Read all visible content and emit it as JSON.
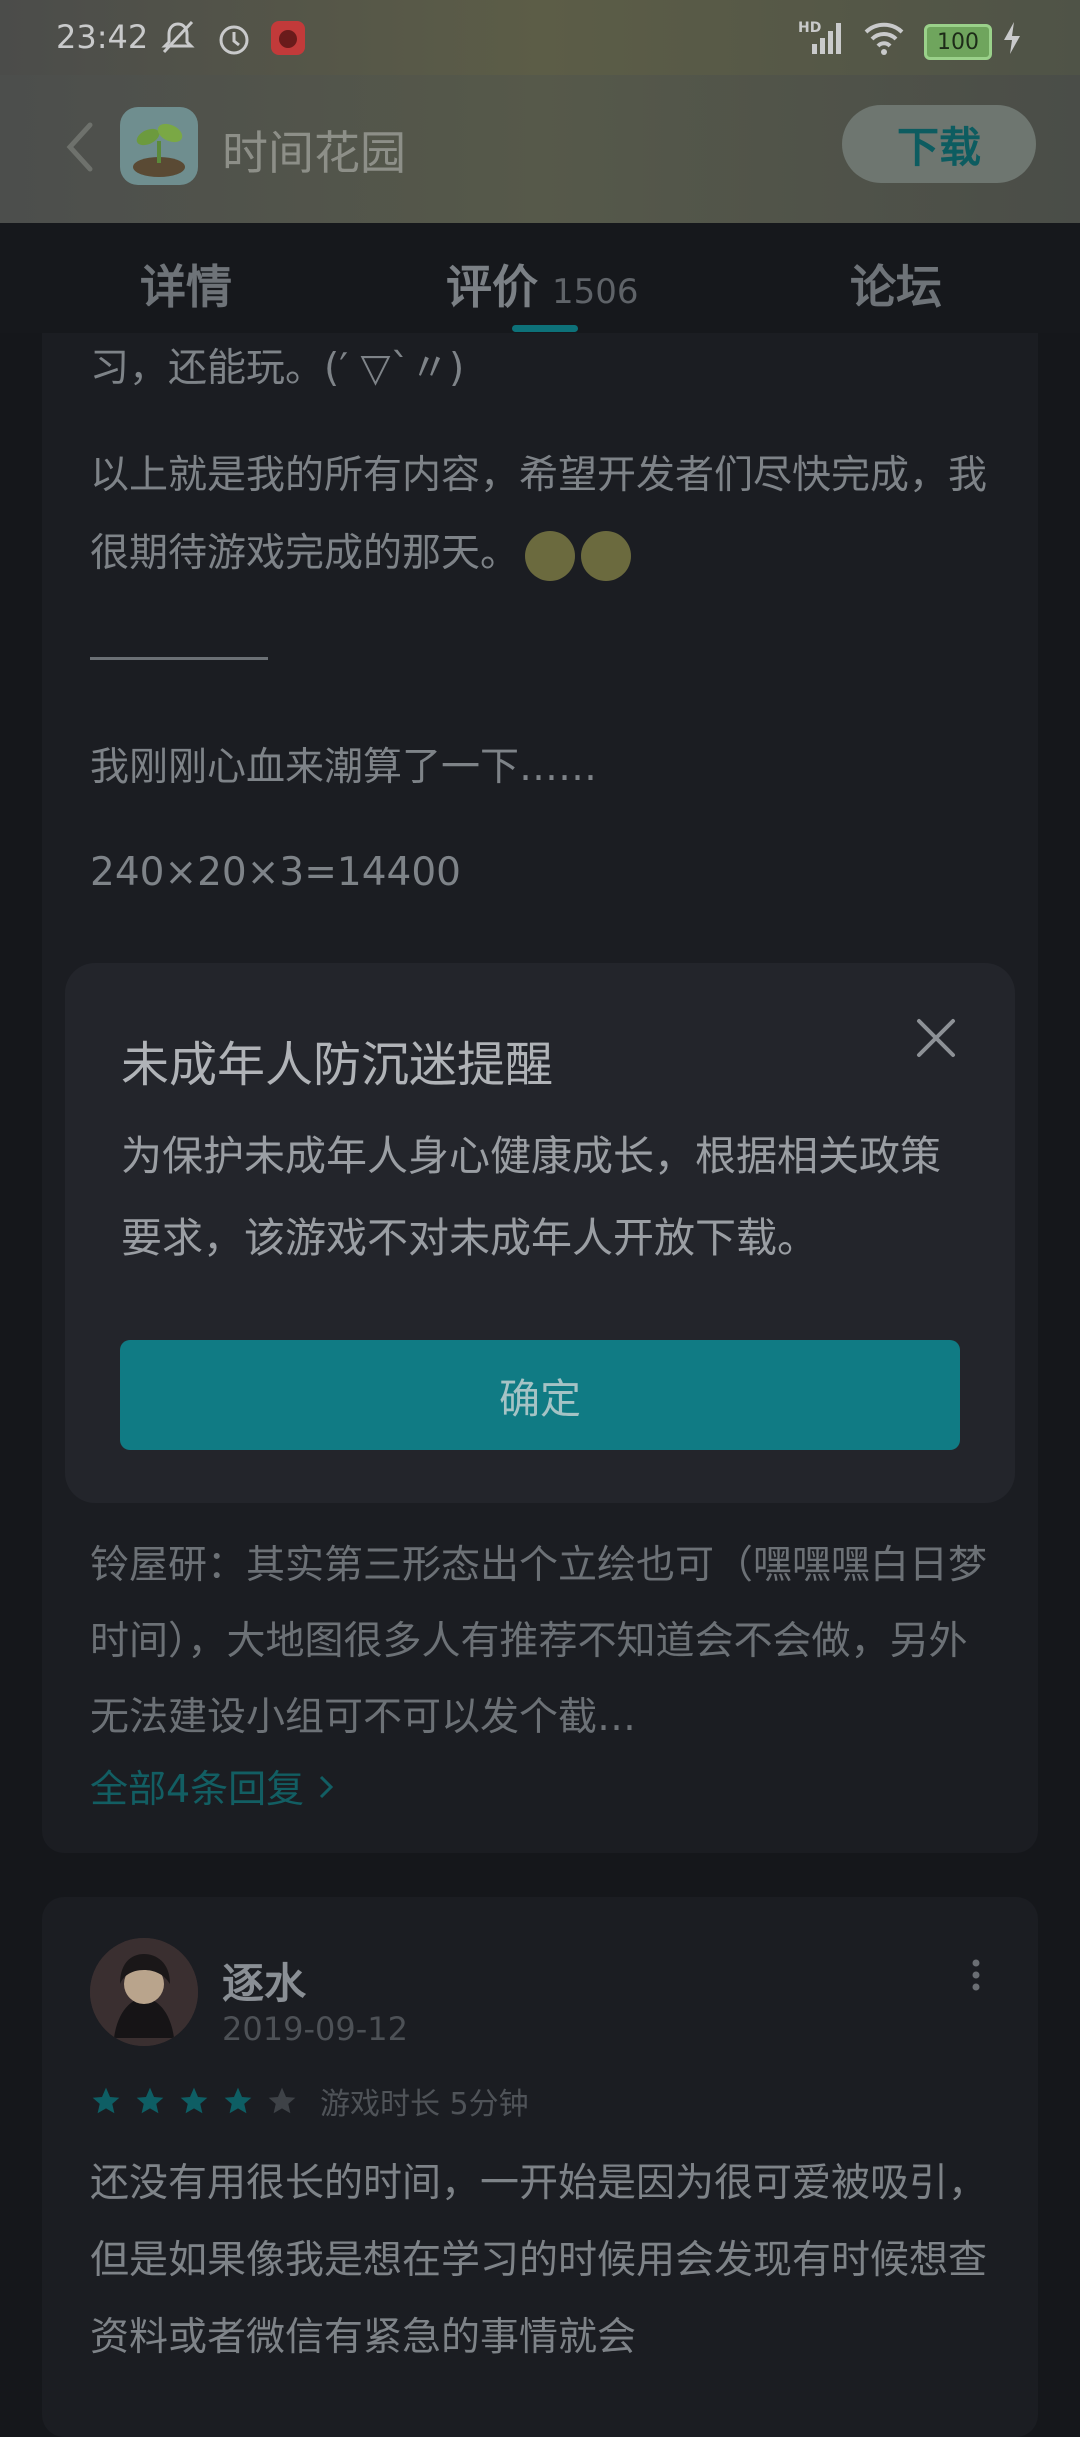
{
  "status_bar": {
    "time": "23:42",
    "battery": "100",
    "network": "HD",
    "icons": [
      "mute-icon",
      "alarm-icon",
      "app-notification-icon",
      "signal-icon",
      "wifi-icon",
      "battery-icon",
      "charging-icon"
    ]
  },
  "app_bar": {
    "title": "时间花园",
    "download_label": "下载"
  },
  "tabs": [
    {
      "label": "详情"
    },
    {
      "label": "评价",
      "count": "1506",
      "active": true
    },
    {
      "label": "论坛"
    }
  ],
  "review1": {
    "line_partial": "习，还能玩。(′ ▽`〃)",
    "para2": "以上就是我的所有内容，希望开发者们尽快完成，我很期待游戏完成的那天。",
    "para3": "我刚刚心血来潮算了一下……",
    "para4": "240×20×3=14400",
    "reply_text": "铃屋研：其实第三形态出个立绘也可（嘿嘿嘿白日梦时间），大地图很多人有推荐不知道会不会做，另外无法建设小组可不可以发个截…",
    "reply_link": "全部4条回复"
  },
  "review2": {
    "user": "逐水",
    "date": "2019-09-12",
    "rating": 4,
    "playtime": "游戏时长 5分钟",
    "text": "还没有用很长的时间，一开始是因为很可爱被吸引，但是如果像我是想在学习的时候用会发现有时候想查资料或者微信有紧急的事情就会"
  },
  "dialog": {
    "title": "未成年人防沉迷提醒",
    "body": "为保护未成年人身心健康成长，根据相关政策要求，该游戏不对未成年人开放下载。",
    "confirm_label": "确定"
  },
  "colors": {
    "accent": "#107b84",
    "background": "#15171b",
    "card": "#1b1d22",
    "dialog": "#23252b"
  }
}
